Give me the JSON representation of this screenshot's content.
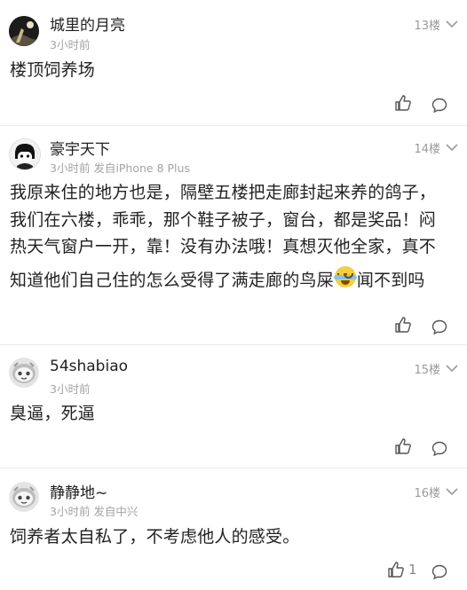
{
  "comments": [
    {
      "username": "城里的月亮",
      "meta": "3小时前",
      "floor": "13楼",
      "lines": [
        "楼顶饲养场"
      ],
      "likes": ""
    },
    {
      "username": "豪宇天下",
      "meta": "3小时前 发自iPhone 8 Plus",
      "floor": "14楼",
      "lines": [
        "我原来住的地方也是，隔壁五楼把走廊封起来养的鸽子，",
        "我们在六楼，乖乖，那个鞋子被子，窗台，都是奖品！闷",
        "热天气窗户一开，靠！没有办法哦！真想灭他全家，真不",
        "知道他们自己住的怎么受得了满走廊的鸟屎",
        "闻不到吗"
      ],
      "likes": ""
    },
    {
      "username": "54shabiao",
      "meta": "3小时前",
      "floor": "15楼",
      "lines": [
        "臭逼，死逼"
      ],
      "likes": ""
    },
    {
      "username": "静静地~",
      "meta": "3小时前 发自中兴",
      "floor": "16楼",
      "lines": [
        "饲养者太自私了，不考虑他人的感受。"
      ],
      "likes": "1"
    }
  ],
  "icons": {
    "like": "thumbs-up-icon",
    "reply": "comment-bubble-icon",
    "more": "chevron-down-icon",
    "emoji": "crying-laughing-emoji-icon"
  },
  "colors": {
    "background": "#ececec",
    "card": "#ffffff",
    "meta_text": "#a3a3a3",
    "icon": "#555555"
  }
}
